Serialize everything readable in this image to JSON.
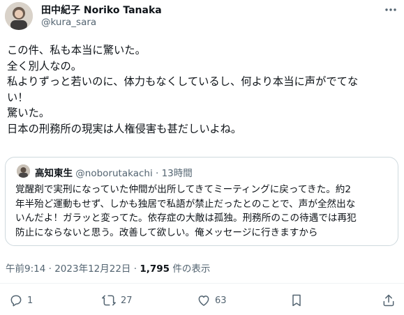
{
  "author": {
    "name": "田中紀子 Noriko Tanaka",
    "handle": "@kura_sara"
  },
  "tweet": {
    "lines": [
      "この件、私も本当に驚いた。",
      "全く別人なの。",
      "私よりずっと若いのに、体力もなくしているし、何より本当に声がでてな",
      "い！",
      "驚いた。",
      "日本の刑務所の現実は人権侵害も甚だしいよね。"
    ]
  },
  "quote": {
    "name": "高知東生",
    "handle": "@noborutakachi",
    "separator": "·",
    "time": "13時間",
    "lines": [
      "覚醒剤で実刑になっていた仲間が出所してきてミーティングに戻ってきた。約2",
      "年半殆ど運動もせず、しかも独居で私語が禁止だったとのことで、声が全然出な",
      "いんだよ！ガラッと変ってた。依存症の大敵は孤独。刑務所のこの待遇では再犯",
      "防止にならないと思う。改善して欲しい。俺メッセージに行きますから"
    ]
  },
  "meta": {
    "time": "午前9:14",
    "separator1": "·",
    "date": "2023年12月22日",
    "separator2": "·",
    "views_count": "1,795",
    "views_label": "件の表示"
  },
  "actions": {
    "reply_count": "1",
    "retweet_count": "27",
    "like_count": "63"
  },
  "icons": {
    "more": "more-dots-icon",
    "reply": "reply-icon",
    "retweet": "retweet-icon",
    "like": "heart-icon",
    "bookmark": "bookmark-icon",
    "share": "share-icon"
  },
  "colors": {
    "text": "#0f1419",
    "secondary": "#536471",
    "border": "#cfd9de"
  }
}
